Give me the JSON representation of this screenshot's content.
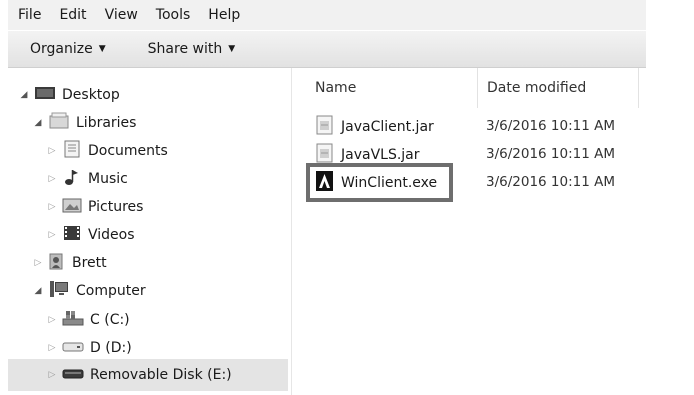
{
  "menubar": {
    "items": [
      "File",
      "Edit",
      "View",
      "Tools",
      "Help"
    ]
  },
  "toolbar": {
    "organize": "Organize",
    "share_with": "Share with"
  },
  "nav": {
    "items": [
      {
        "label": "Desktop",
        "icon": "desktop-icon"
      },
      {
        "label": "Libraries",
        "icon": "libraries-icon"
      },
      {
        "label": "Documents",
        "icon": "documents-icon"
      },
      {
        "label": "Music",
        "icon": "music-icon"
      },
      {
        "label": "Pictures",
        "icon": "pictures-icon"
      },
      {
        "label": "Videos",
        "icon": "videos-icon"
      },
      {
        "label": "Brett",
        "icon": "user-folder-icon"
      },
      {
        "label": "Computer",
        "icon": "computer-icon"
      },
      {
        "label": "C (C:)",
        "icon": "system-drive-icon"
      },
      {
        "label": "D (D:)",
        "icon": "drive-icon"
      },
      {
        "label": "Removable Disk (E:)",
        "icon": "removable-disk-icon"
      }
    ]
  },
  "columns": {
    "name": "Name",
    "date_modified": "Date modified"
  },
  "files": [
    {
      "name": "JavaClient.jar",
      "date": "3/6/2016 10:11 AM",
      "icon": "jar-file-icon"
    },
    {
      "name": "JavaVLS.jar",
      "date": "3/6/2016 10:11 AM",
      "icon": "jar-file-icon"
    },
    {
      "name": "WinClient.exe",
      "date": "3/6/2016 10:11 AM",
      "icon": "exe-file-icon"
    }
  ]
}
